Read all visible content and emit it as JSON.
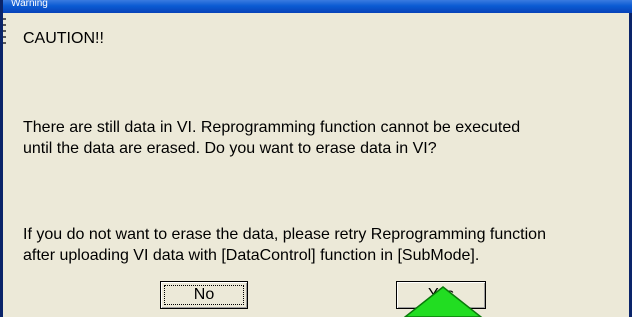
{
  "window": {
    "title": "Warning"
  },
  "message": {
    "caution": "CAUTION!!",
    "paragraph1": [
      "There are still data in VI. Reprogramming function cannot be executed",
      "until the data are erased. Do you want to erase data in VI?"
    ],
    "paragraph2": [
      "If you do not want to erase the data, please retry Reprogramming function",
      "after uploading VI data with [DataControl] function in [SubMode]."
    ]
  },
  "buttons": {
    "no_label": "No",
    "yes_label": "Yes"
  },
  "colors": {
    "titlebar": "#0b5bd3",
    "dialog_background": "#ece9d8",
    "pointer_arrow": "#22dd22"
  },
  "icons": {
    "pointer": "green-arrow-icon"
  }
}
